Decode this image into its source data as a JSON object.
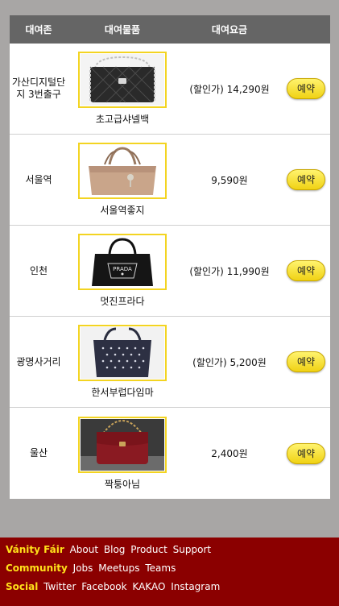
{
  "table": {
    "headers": {
      "location": "대여존",
      "item": "대여물품",
      "price": "대여요금"
    },
    "rows": [
      {
        "location": "가산디지털단지 3번출구",
        "item": "초고급샤넬백",
        "price": "(할인가) 14,290원",
        "button": "예약",
        "image": "black-quilted-chain-bag-icon"
      },
      {
        "location": "서울역",
        "item": "서울역좋지",
        "price": "9,590원",
        "button": "예약",
        "image": "beige-tote-bag-icon"
      },
      {
        "location": "인천",
        "item": "멋진프라다",
        "price": "(할인가) 11,990원",
        "button": "예약",
        "image": "black-prada-tote-icon"
      },
      {
        "location": "광명사거리",
        "item": "한서부럽다임마",
        "price": "(할인가) 5,200원",
        "button": "예약",
        "image": "studded-navy-bag-icon"
      },
      {
        "location": "울산",
        "item": "짝퉁아님",
        "price": "2,400원",
        "button": "예약",
        "image": "red-chain-bag-icon"
      }
    ]
  },
  "footer": {
    "rows": [
      {
        "head": "Vánity Fáir",
        "links": [
          "About",
          "Blog",
          "Product",
          "Support"
        ]
      },
      {
        "head": "Community",
        "links": [
          "Jobs",
          "Meetups",
          "Teams"
        ]
      },
      {
        "head": "Social",
        "links": [
          "Twitter",
          "Facebook",
          "KAKAO",
          "Instagram"
        ]
      }
    ]
  },
  "colors": {
    "header": "#656565",
    "footer": "#8b0000",
    "accent": "#f3d421",
    "background": "#a8a6a5"
  }
}
